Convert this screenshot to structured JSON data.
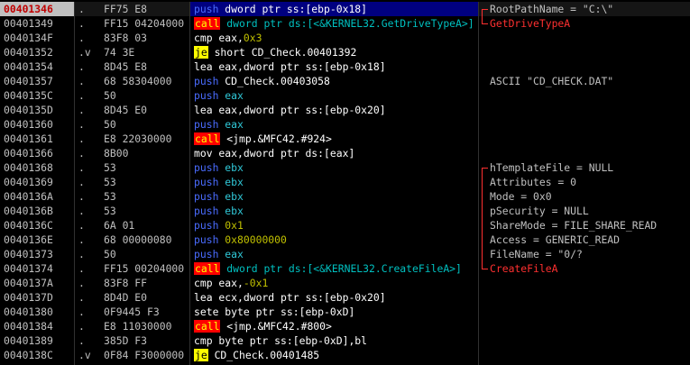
{
  "rows": [
    {
      "addr": "00401346",
      "mark": ".",
      "hex": "FF75 E8",
      "ins": [
        {
          "t": "push",
          "c": "push"
        },
        {
          "t": " dword ptr ss:[ebp-0x18]",
          "c": "white"
        }
      ],
      "cmt": "RootPathName = \"C:\\\"",
      "br": "top",
      "selected": true
    },
    {
      "addr": "00401349",
      "mark": ".",
      "hex": "FF15 04204000",
      "ins": [
        {
          "t": "call",
          "c": "call"
        },
        {
          "t": " dword ptr ds:[<&KERNEL32.GetDriveTypeA>]",
          "c": "cyan"
        }
      ],
      "cmt": "GetDriveTypeA",
      "br": "bot",
      "cmtc": "red"
    },
    {
      "addr": "0040134F",
      "mark": ".",
      "hex": "83F8 03",
      "ins": [
        {
          "t": "cmp eax,",
          "c": "white"
        },
        {
          "t": "0x3",
          "c": "num"
        }
      ],
      "cmt": ""
    },
    {
      "addr": "00401352",
      "mark": ".v",
      "hex": "74 3E",
      "ins": [
        {
          "t": "je",
          "c": "je"
        },
        {
          "t": " short CD_Check.00401392",
          "c": "white"
        }
      ],
      "cmt": ""
    },
    {
      "addr": "00401354",
      "mark": ".",
      "hex": "8D45 E8",
      "ins": [
        {
          "t": "lea eax,dword ptr ss:[ebp-0x18]",
          "c": "white"
        }
      ],
      "cmt": ""
    },
    {
      "addr": "00401357",
      "mark": ".",
      "hex": "68 58304000",
      "ins": [
        {
          "t": "push",
          "c": "push"
        },
        {
          "t": " CD_Check.00403058",
          "c": "white"
        }
      ],
      "cmt": "ASCII \"CD_CHECK.DAT\""
    },
    {
      "addr": "0040135C",
      "mark": ".",
      "hex": "50",
      "ins": [
        {
          "t": "push",
          "c": "push"
        },
        {
          "t": " eax",
          "c": "cyanv"
        }
      ],
      "cmt": ""
    },
    {
      "addr": "0040135D",
      "mark": ".",
      "hex": "8D45 E0",
      "ins": [
        {
          "t": "lea eax,dword ptr ss:[ebp-0x20]",
          "c": "white"
        }
      ],
      "cmt": ""
    },
    {
      "addr": "00401360",
      "mark": ".",
      "hex": "50",
      "ins": [
        {
          "t": "push",
          "c": "push"
        },
        {
          "t": " eax",
          "c": "cyanv"
        }
      ],
      "cmt": ""
    },
    {
      "addr": "00401361",
      "mark": ".",
      "hex": "E8 22030000",
      "ins": [
        {
          "t": "call",
          "c": "call"
        },
        {
          "t": " <jmp.&MFC42.#924>",
          "c": "white"
        }
      ],
      "cmt": ""
    },
    {
      "addr": "00401366",
      "mark": ".",
      "hex": "8B00",
      "ins": [
        {
          "t": "mov eax,dword ptr ds:[eax]",
          "c": "white"
        }
      ],
      "cmt": ""
    },
    {
      "addr": "00401368",
      "mark": ".",
      "hex": "53",
      "ins": [
        {
          "t": "push",
          "c": "push"
        },
        {
          "t": " ebx",
          "c": "cyanv"
        }
      ],
      "cmt": "hTemplateFile = NULL",
      "br": "top"
    },
    {
      "addr": "00401369",
      "mark": ".",
      "hex": "53",
      "ins": [
        {
          "t": "push",
          "c": "push"
        },
        {
          "t": " ebx",
          "c": "cyanv"
        }
      ],
      "cmt": "Attributes = 0",
      "br": "mid"
    },
    {
      "addr": "0040136A",
      "mark": ".",
      "hex": "53",
      "ins": [
        {
          "t": "push",
          "c": "push"
        },
        {
          "t": " ebx",
          "c": "cyanv"
        }
      ],
      "cmt": "Mode = 0x0",
      "br": "mid"
    },
    {
      "addr": "0040136B",
      "mark": ".",
      "hex": "53",
      "ins": [
        {
          "t": "push",
          "c": "push"
        },
        {
          "t": " ebx",
          "c": "cyanv"
        }
      ],
      "cmt": "pSecurity = NULL",
      "br": "mid"
    },
    {
      "addr": "0040136C",
      "mark": ".",
      "hex": "6A 01",
      "ins": [
        {
          "t": "push",
          "c": "push"
        },
        {
          "t": " 0x1",
          "c": "num"
        }
      ],
      "cmt": "ShareMode = FILE_SHARE_READ",
      "br": "mid"
    },
    {
      "addr": "0040136E",
      "mark": ".",
      "hex": "68 00000080",
      "ins": [
        {
          "t": "push",
          "c": "push"
        },
        {
          "t": " 0x80000000",
          "c": "num"
        }
      ],
      "cmt": "Access = GENERIC_READ",
      "br": "mid"
    },
    {
      "addr": "00401373",
      "mark": ".",
      "hex": "50",
      "ins": [
        {
          "t": "push",
          "c": "push"
        },
        {
          "t": " eax",
          "c": "cyanv"
        }
      ],
      "cmt": "FileName = \"0/?",
      "br": "mid"
    },
    {
      "addr": "00401374",
      "mark": ".",
      "hex": "FF15 00204000",
      "ins": [
        {
          "t": "call",
          "c": "call"
        },
        {
          "t": " dword ptr ds:[<&KERNEL32.CreateFileA>]",
          "c": "cyan"
        }
      ],
      "cmt": "CreateFileA",
      "br": "bot",
      "cmtc": "red"
    },
    {
      "addr": "0040137A",
      "mark": ".",
      "hex": "83F8 FF",
      "ins": [
        {
          "t": "cmp eax,",
          "c": "white"
        },
        {
          "t": "-0x1",
          "c": "num"
        }
      ],
      "cmt": ""
    },
    {
      "addr": "0040137D",
      "mark": ".",
      "hex": "8D4D E0",
      "ins": [
        {
          "t": "lea ecx,dword ptr ss:[ebp-0x20]",
          "c": "white"
        }
      ],
      "cmt": ""
    },
    {
      "addr": "00401380",
      "mark": ".",
      "hex": "0F9445 F3",
      "ins": [
        {
          "t": "sete byte ptr ss:[ebp-0xD]",
          "c": "white"
        }
      ],
      "cmt": ""
    },
    {
      "addr": "00401384",
      "mark": ".",
      "hex": "E8 11030000",
      "ins": [
        {
          "t": "call",
          "c": "call"
        },
        {
          "t": " <jmp.&MFC42.#800>",
          "c": "white"
        }
      ],
      "cmt": ""
    },
    {
      "addr": "00401389",
      "mark": ".",
      "hex": "385D F3",
      "ins": [
        {
          "t": "cmp byte ptr ss:[ebp-0xD],bl",
          "c": "white"
        }
      ],
      "cmt": ""
    },
    {
      "addr": "0040138C",
      "mark": ".v",
      "hex": "0F84 F3000000",
      "ins": [
        {
          "t": "je",
          "c": "je"
        },
        {
          "t": " CD_Check.00401485",
          "c": "white"
        }
      ],
      "cmt": ""
    }
  ]
}
